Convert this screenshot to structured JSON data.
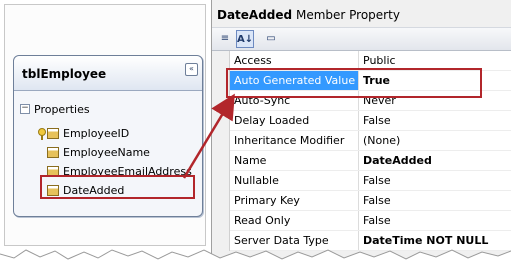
{
  "designer": {
    "entity_title": "tblEmployee",
    "collapse_glyph": "«",
    "properties_expander": "−",
    "properties_label": "Properties",
    "properties": [
      {
        "label": "EmployeeID",
        "icon": "key-icon"
      },
      {
        "label": "EmployeeName",
        "icon": "property-icon"
      },
      {
        "label": "EmployeeEmailAddress",
        "icon": "property-icon"
      },
      {
        "label": "DateAdded",
        "icon": "property-icon"
      }
    ]
  },
  "property_panel": {
    "title_bold": "DateAdded",
    "title_rest": "Member Property",
    "toolbar": {
      "categorized": "≡",
      "alphabetical": "A↓",
      "pages": "▭"
    },
    "rows": [
      {
        "name": "Access",
        "value": "Public",
        "bold": false
      },
      {
        "name": "Auto Generated Value",
        "value": "True",
        "bold": true,
        "selected": true
      },
      {
        "name": "Auto-Sync",
        "value": "Never",
        "bold": false
      },
      {
        "name": "Delay Loaded",
        "value": "False",
        "bold": false
      },
      {
        "name": "Inheritance Modifier",
        "value": "(None)",
        "bold": false
      },
      {
        "name": "Name",
        "value": "DateAdded",
        "bold": true
      },
      {
        "name": "Nullable",
        "value": "False",
        "bold": false
      },
      {
        "name": "Primary Key",
        "value": "False",
        "bold": false
      },
      {
        "name": "Read Only",
        "value": "False",
        "bold": false
      },
      {
        "name": "Server Data Type",
        "value": "DateTime NOT NULL",
        "bold": true
      }
    ]
  },
  "colors": {
    "highlight_border": "#b2262b",
    "selected_row": "#3399ff",
    "arrow": "#b2262b"
  }
}
